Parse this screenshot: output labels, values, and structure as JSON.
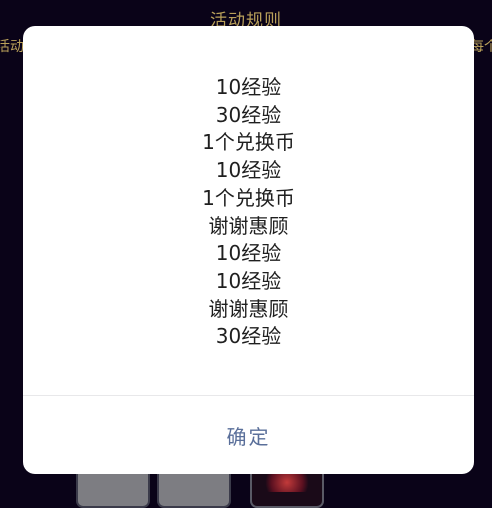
{
  "background": {
    "title": "活动规则",
    "left_text": "活动",
    "right_text": "每个"
  },
  "dialog": {
    "lines": [
      "10经验",
      "30经验",
      "1个兑换币",
      "10经验",
      "1个兑换币",
      "谢谢惠顾",
      "10经验",
      "10经验",
      "谢谢惠顾",
      " 30经验"
    ],
    "confirm_label": "确定"
  }
}
